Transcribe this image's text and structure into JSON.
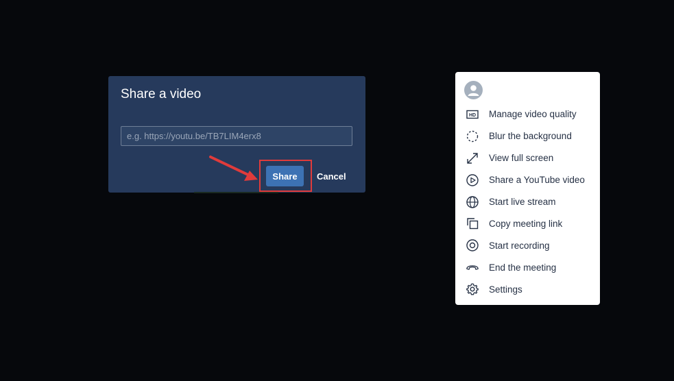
{
  "dialog": {
    "title": "Share a video",
    "input_value": "",
    "input_placeholder": "e.g. https://youtu.be/TB7LIM4erx8",
    "share_label": "Share",
    "cancel_label": "Cancel"
  },
  "menu": {
    "avatar_icon": "person-icon",
    "items": [
      {
        "label": "Manage video quality",
        "icon": "hd-icon"
      },
      {
        "label": "Blur the background",
        "icon": "blur-icon"
      },
      {
        "label": "View full screen",
        "icon": "fullscreen-icon"
      },
      {
        "label": "Share a YouTube video",
        "icon": "play-circle-icon"
      },
      {
        "label": "Start live stream",
        "icon": "globe-icon"
      },
      {
        "label": "Copy meeting link",
        "icon": "copy-icon"
      },
      {
        "label": "Start recording",
        "icon": "record-icon"
      },
      {
        "label": "End the meeting",
        "icon": "hangup-icon"
      },
      {
        "label": "Settings",
        "icon": "gear-icon"
      }
    ]
  },
  "colors": {
    "background": "#06080c",
    "dialog_bg": "#263a5c",
    "share_button": "#3d72b4",
    "highlight": "#e03b3b",
    "menu_bg": "#ffffff",
    "menu_text": "#253044"
  }
}
